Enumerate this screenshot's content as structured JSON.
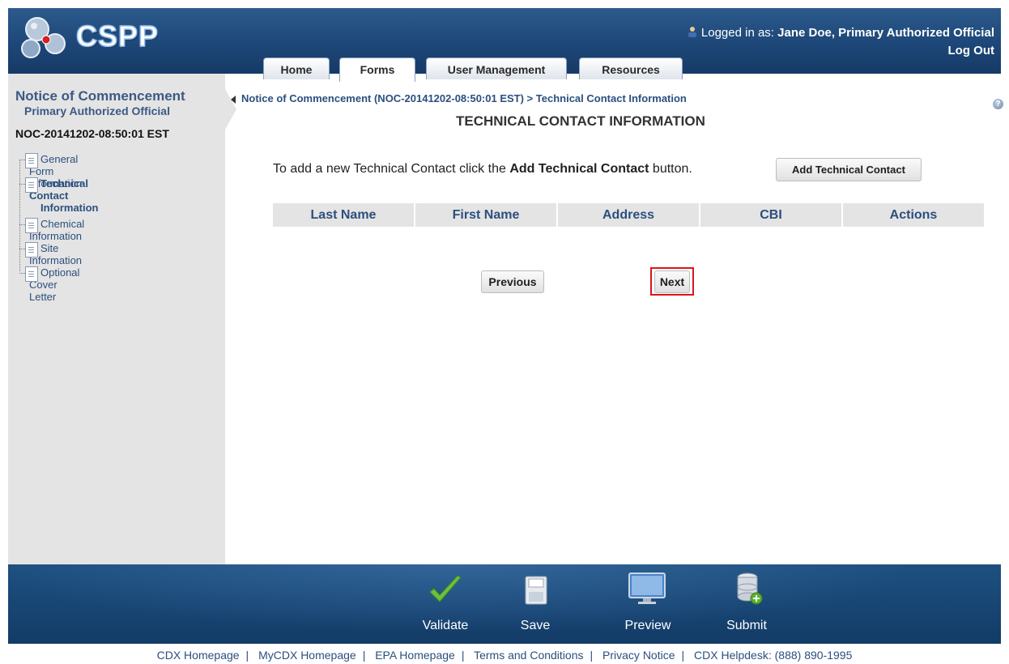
{
  "app": {
    "name": "CSPP"
  },
  "header": {
    "logged_in_prefix": "Logged in as:",
    "user_name": "Jane Doe, Primary Authorized Official",
    "logout_label": "Log Out",
    "tabs": [
      {
        "label": "Home",
        "active": false
      },
      {
        "label": "Forms",
        "active": true
      },
      {
        "label": "User Management",
        "active": false
      },
      {
        "label": "Resources",
        "active": false
      }
    ]
  },
  "sidebar": {
    "title": "Notice of Commencement",
    "subtitle": "Primary Authorized Official",
    "form_id": "NOC-20141202-08:50:01 EST",
    "items": [
      {
        "label": "General Form Information",
        "active": false
      },
      {
        "label": "Technical Contact",
        "label2": "Information",
        "active": true
      },
      {
        "label": "Chemical Information",
        "active": false
      },
      {
        "label": "Site Information",
        "active": false
      },
      {
        "label": "Optional Cover Letter",
        "active": false
      }
    ]
  },
  "main": {
    "breadcrumb": "Notice of Commencement (NOC-20141202-08:50:01 EST) > Technical Contact Information",
    "title": "TECHNICAL CONTACT INFORMATION",
    "instruction_pre": "To add a new Technical Contact click the ",
    "instruction_bold": "Add Technical Contact",
    "instruction_post": " button.",
    "add_button": "Add Technical Contact",
    "columns": [
      "Last Name",
      "First Name",
      "Address",
      "CBI",
      "Actions"
    ],
    "previous_button": "Previous",
    "next_button": "Next"
  },
  "footer": {
    "actions": [
      {
        "label": "Validate",
        "icon": "checkmark-icon"
      },
      {
        "label": "Save",
        "icon": "floppy-disk-icon"
      },
      {
        "label": "Preview",
        "icon": "monitor-icon"
      },
      {
        "label": "Submit",
        "icon": "database-add-icon"
      }
    ],
    "links": [
      "CDX Homepage",
      "MyCDX Homepage",
      "EPA Homepage",
      "Terms and Conditions",
      "Privacy Notice",
      "CDX Helpdesk: (888) 890-1995"
    ]
  },
  "colors": {
    "header_blue": "#1d4778",
    "link_blue": "#2b4f7e",
    "sidebar_gray": "#e4e4e4",
    "highlight_red": "#d7161d"
  }
}
